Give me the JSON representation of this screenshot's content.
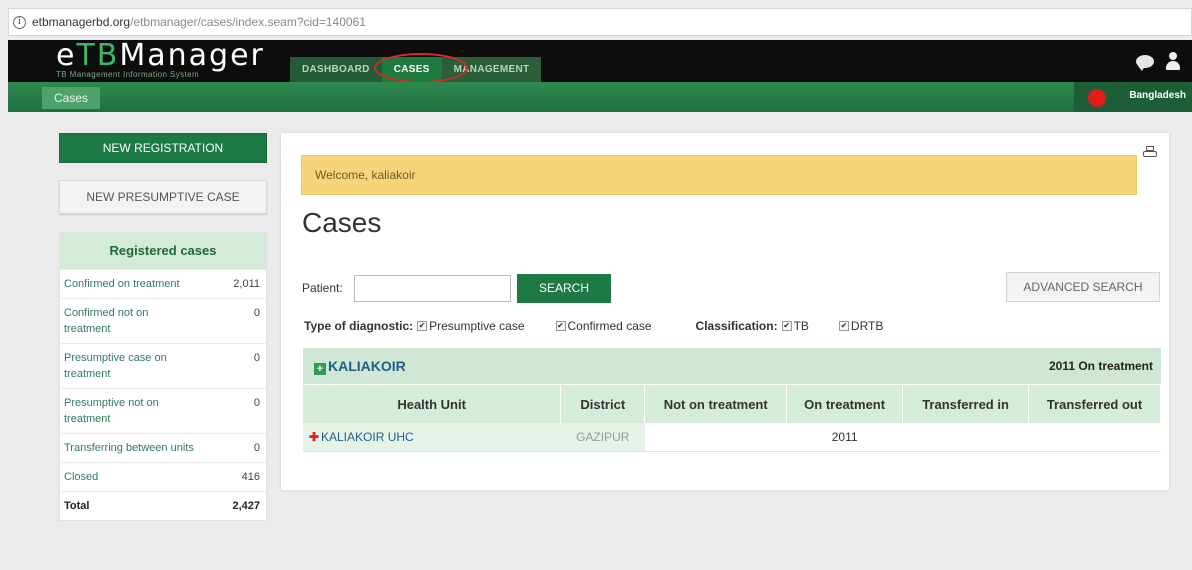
{
  "browser": {
    "url_domain": "etbmanagerbd.org",
    "url_path": "/etbmanager/cases/index.seam?cid=140061"
  },
  "header": {
    "logo_prefix": "e",
    "logo_tb": "TB",
    "logo_suffix": "Manager",
    "logo_subtitle": "TB Management Information System",
    "tabs": [
      {
        "label": "DASHBOARD",
        "active": false
      },
      {
        "label": "CASES",
        "active": true
      },
      {
        "label": "MANAGEMENT",
        "active": false
      }
    ],
    "breadcrumb": "Cases",
    "country": "Bangladesh"
  },
  "sidebar": {
    "new_registration": "NEW REGISTRATION",
    "new_presumptive": "NEW PRESUMPTIVE CASE",
    "registered_title": "Registered cases",
    "rows": [
      {
        "label": "Confirmed on treatment",
        "value": "2,011"
      },
      {
        "label": "Confirmed not on treatment",
        "value": "0"
      },
      {
        "label": "Presumptive case on treatment",
        "value": "0"
      },
      {
        "label": "Presumptive not on treatment",
        "value": "0"
      },
      {
        "label": "Transferring between units",
        "value": "0"
      },
      {
        "label": "Closed",
        "value": "416"
      },
      {
        "label": "Total",
        "value": "2,427"
      }
    ]
  },
  "main": {
    "welcome": "Welcome, kaliakoir",
    "title": "Cases",
    "patient_label": "Patient:",
    "patient_value": "",
    "search_label": "SEARCH",
    "advanced_label": "ADVANCED SEARCH",
    "diag_label": "Type of diagnostic:",
    "diag_options": [
      "Presumptive case",
      "Confirmed case"
    ],
    "class_label": "Classification:",
    "class_options": [
      "TB",
      "DRTB"
    ],
    "unit_group": "KALIAKOIR",
    "unit_group_count": "2011 On treatment",
    "columns": [
      "Health Unit",
      "District",
      "Not on treatment",
      "On treatment",
      "Transferred in",
      "Transferred out"
    ],
    "rows": [
      {
        "health_unit": "KALIAKOIR UHC",
        "district": "GAZIPUR",
        "not_on_treatment": "",
        "on_treatment": "2011",
        "transferred_in": "",
        "transferred_out": ""
      }
    ]
  }
}
